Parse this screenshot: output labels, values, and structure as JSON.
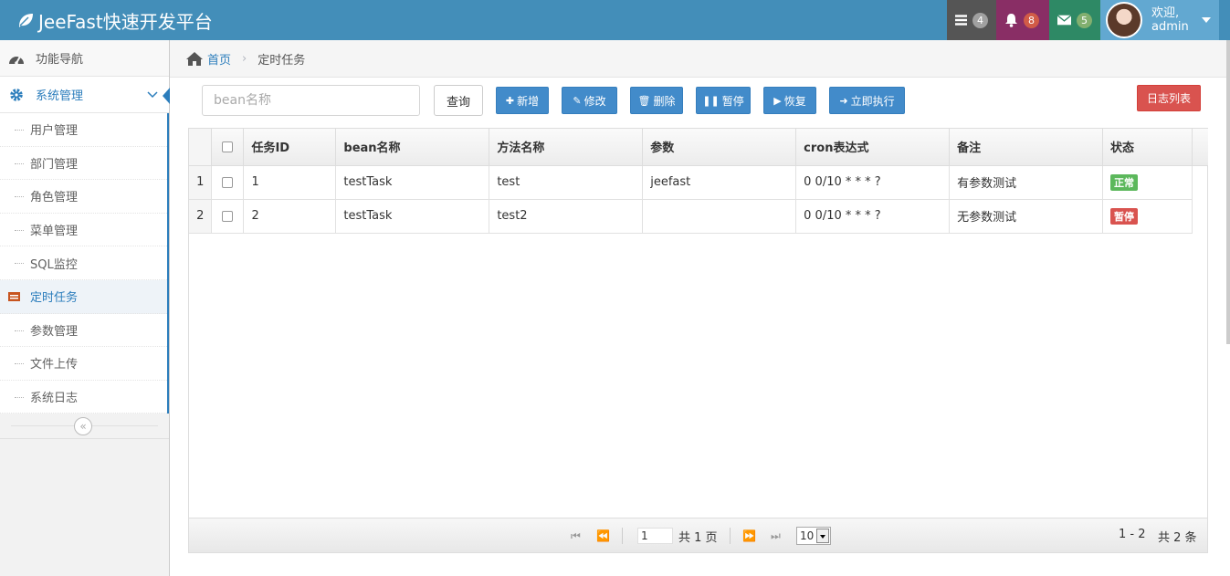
{
  "app": {
    "title": "JeeFast快速开发平台"
  },
  "navbar": {
    "tasks_count": "4",
    "notifications_count": "8",
    "messages_count": "5",
    "welcome": "欢迎,",
    "username": "admin"
  },
  "sidebar": {
    "nav_label": "功能导航",
    "group_label": "系统管理",
    "items": [
      {
        "label": "用户管理"
      },
      {
        "label": "部门管理"
      },
      {
        "label": "角色管理"
      },
      {
        "label": "菜单管理"
      },
      {
        "label": "SQL监控"
      },
      {
        "label": "定时任务"
      },
      {
        "label": "参数管理"
      },
      {
        "label": "文件上传"
      },
      {
        "label": "系统日志"
      }
    ]
  },
  "breadcrumb": {
    "home": "首页",
    "current": "定时任务"
  },
  "toolbar": {
    "search_placeholder": "bean名称",
    "query": "查询",
    "add": "新增",
    "edit": "修改",
    "delete": "删除",
    "pause": "暂停",
    "resume": "恢复",
    "run_now": "立即执行",
    "log_list": "日志列表"
  },
  "table": {
    "headers": [
      "任务ID",
      "bean名称",
      "方法名称",
      "参数",
      "cron表达式",
      "备注",
      "状态"
    ],
    "rows": [
      {
        "rownum": "1",
        "id": "1",
        "bean": "testTask",
        "method": "test",
        "params": "jeefast",
        "cron": "0 0/10 * * * ?",
        "remark": "有参数测试",
        "status": "正常"
      },
      {
        "rownum": "2",
        "id": "2",
        "bean": "testTask",
        "method": "test2",
        "params": "",
        "cron": "0 0/10 * * * ?",
        "remark": "无参数测试",
        "status": "暂停"
      }
    ]
  },
  "pager": {
    "page": "1",
    "total_pages": "共 1 页",
    "page_size": "10",
    "range": "1 - 2",
    "total": "共 2 条"
  },
  "colors": {
    "navbar": "#438eb9",
    "accent": "#2b7dbc",
    "primary_btn": "#428bca",
    "danger_btn": "#d9534f"
  }
}
